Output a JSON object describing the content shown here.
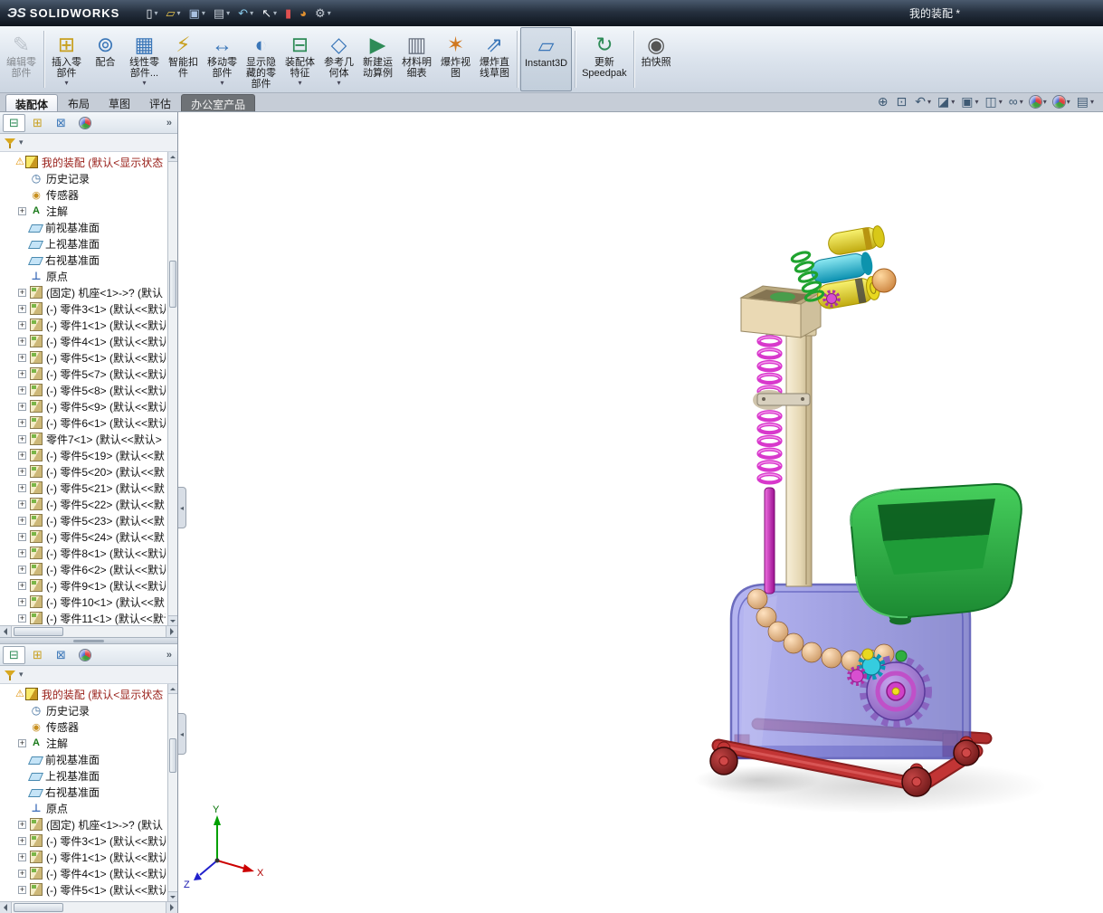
{
  "titlebar": {
    "logo_mark": "ЭS",
    "logo_text": "SOLIDWORKS",
    "title": "我的装配 *",
    "quick_icons": [
      {
        "name": "new-document-icon",
        "glyph": "▯",
        "color": "#f0f4f8",
        "flags": "dd"
      },
      {
        "name": "open-folder-icon",
        "glyph": "▱",
        "color": "#e8c44a",
        "flags": "dd"
      },
      {
        "name": "save-icon",
        "glyph": "▣",
        "color": "#a8c0e0",
        "flags": "dd"
      },
      {
        "name": "print-icon",
        "glyph": "▤",
        "color": "#c2cad4",
        "flags": "dd"
      },
      {
        "name": "undo-icon",
        "glyph": "↶",
        "color": "#88c8e8",
        "flags": "dd"
      },
      {
        "name": "select-cursor-icon",
        "glyph": "↖",
        "color": "#f0f4f8",
        "flags": "dd"
      },
      {
        "name": "rebuild-icon",
        "glyph": "▮",
        "color": "#e05050",
        "flags": ""
      },
      {
        "name": "appearance-icon",
        "glyph": "◕",
        "color": "#e09030",
        "flags": ""
      },
      {
        "name": "options-icon",
        "glyph": "⚙",
        "color": "#c6cdd6",
        "flags": "dd"
      }
    ]
  },
  "ribbon": {
    "buttons": [
      {
        "name": "edit-component-button",
        "label": "编辑零\n部件",
        "glyph": "✎",
        "color": "#8a929c",
        "flags": "disabled"
      },
      {
        "divider": true
      },
      {
        "name": "insert-component-button",
        "label": "插入零\n部件",
        "glyph": "⊞",
        "color": "#c8a020",
        "flags": "dd"
      },
      {
        "name": "mate-button",
        "label": "配合",
        "glyph": "⊚",
        "color": "#3a76b8",
        "flags": ""
      },
      {
        "name": "linear-component-pattern-button",
        "label": "线性零\n部件...",
        "glyph": "▦",
        "color": "#3a76b8",
        "flags": "dd"
      },
      {
        "name": "smart-fasteners-button",
        "label": "智能扣\n件",
        "glyph": "⚡",
        "color": "#c8a020",
        "flags": ""
      },
      {
        "name": "move-component-button",
        "label": "移动零\n部件",
        "glyph": "↔",
        "color": "#3a76b8",
        "flags": "dd"
      },
      {
        "name": "show-hidden-components-button",
        "label": "显示隐\n藏的零\n部件",
        "glyph": "◐",
        "color": "#3a76b8",
        "flags": ""
      },
      {
        "name": "assembly-features-button",
        "label": "装配体\n特征",
        "glyph": "⊟",
        "color": "#2e8b57",
        "flags": "dd"
      },
      {
        "name": "reference-geometry-button",
        "label": "参考几\n何体",
        "glyph": "◇",
        "color": "#3a76b8",
        "flags": "dd"
      },
      {
        "name": "new-motion-study-button",
        "label": "新建运\n动算例",
        "glyph": "▶",
        "color": "#2e8b57",
        "flags": ""
      },
      {
        "name": "bill-of-materials-button",
        "label": "材料明\n细表",
        "glyph": "▥",
        "color": "#6a7280",
        "flags": ""
      },
      {
        "name": "exploded-view-button",
        "label": "爆炸视\n图",
        "glyph": "✶",
        "color": "#d07820",
        "flags": ""
      },
      {
        "name": "explode-line-sketch-button",
        "label": "爆炸直\n线草图",
        "glyph": "⇗",
        "color": "#3a76b8",
        "flags": ""
      },
      {
        "divider": true
      },
      {
        "name": "instant3d-button",
        "label": "Instant3D",
        "glyph": "▱",
        "color": "#3a76b8",
        "flags": "active"
      },
      {
        "divider": true
      },
      {
        "name": "update-speedpak-button",
        "label": "更新\nSpeedpak",
        "glyph": "↻",
        "color": "#2e8b57",
        "flags": ""
      },
      {
        "divider": true
      },
      {
        "name": "take-snapshot-button",
        "label": "拍快照",
        "glyph": "◉",
        "color": "#555555",
        "flags": ""
      }
    ]
  },
  "tabs": {
    "items": [
      {
        "name": "tab-assembly",
        "label": "装配体",
        "flags": "active"
      },
      {
        "name": "tab-layout",
        "label": "布局",
        "flags": ""
      },
      {
        "name": "tab-sketch",
        "label": "草图",
        "flags": ""
      },
      {
        "name": "tab-evaluate",
        "label": "评估",
        "flags": ""
      },
      {
        "name": "tab-office-products",
        "label": "办公室产品",
        "flags": "dark"
      }
    ]
  },
  "viewtools": {
    "items": [
      {
        "name": "zoom-fit-icon",
        "glyph": "⊕",
        "color": "#3f5a74",
        "flags": ""
      },
      {
        "name": "zoom-to-area-icon",
        "glyph": "⊡",
        "color": "#3f5a74",
        "flags": ""
      },
      {
        "name": "previous-view-icon",
        "glyph": "↶",
        "color": "#3f5a74",
        "flags": "dd"
      },
      {
        "name": "section-view-icon",
        "glyph": "◪",
        "color": "#3f5a74",
        "flags": "dd"
      },
      {
        "name": "view-orientation-icon",
        "glyph": "▣",
        "color": "#3f5a74",
        "flags": "dd"
      },
      {
        "name": "display-style-icon",
        "glyph": "◫",
        "color": "#3f5a74",
        "flags": "dd"
      },
      {
        "name": "hide-show-items-icon",
        "glyph": "∞",
        "color": "#3f5a74",
        "flags": "dd"
      },
      {
        "name": "edit-appearance-icon",
        "glyph": "●",
        "color": "#3f5a74",
        "flags": "ball dd"
      },
      {
        "name": "apply-scene-icon",
        "glyph": "●",
        "color": "#3f5a74",
        "flags": "ball dd"
      },
      {
        "name": "view-settings-icon",
        "glyph": "▤",
        "color": "#3f5a74",
        "flags": "dd"
      }
    ]
  },
  "panels": {
    "tabs": [
      {
        "name": "featuremanager-tree-tab",
        "glyph": "⊟",
        "color": "#2e8b57",
        "flags": "active"
      },
      {
        "name": "propertymanager-tab",
        "glyph": "⊞",
        "color": "#c8a020",
        "flags": ""
      },
      {
        "name": "configurationmanager-tab",
        "glyph": "⊠",
        "color": "#3a76b8",
        "flags": ""
      },
      {
        "name": "displaymanager-tab",
        "glyph": "●",
        "color": "#3f5a74",
        "flags": "ball"
      }
    ],
    "tree1": [
      {
        "icon": "assembly",
        "flags": "root warn red",
        "label": "我的装配 (默认<显示状态"
      },
      {
        "icon": "history",
        "flags": "",
        "label": "历史记录"
      },
      {
        "icon": "sensor",
        "flags": "",
        "label": "传感器"
      },
      {
        "icon": "annot",
        "flags": "exp",
        "label": "注解"
      },
      {
        "icon": "plane",
        "flags": "",
        "label": "前视基准面"
      },
      {
        "icon": "plane",
        "flags": "",
        "label": "上视基准面"
      },
      {
        "icon": "plane",
        "flags": "",
        "label": "右视基准面"
      },
      {
        "icon": "origin",
        "flags": "",
        "label": "原点"
      },
      {
        "icon": "part",
        "flags": "exp",
        "label": "(固定) 机座<1>->? (默认"
      },
      {
        "icon": "part",
        "flags": "exp",
        "label": "(-) 零件3<1> (默认<<默认"
      },
      {
        "icon": "part",
        "flags": "exp",
        "label": "(-) 零件1<1> (默认<<默认"
      },
      {
        "icon": "part",
        "flags": "exp",
        "label": "(-) 零件4<1> (默认<<默认"
      },
      {
        "icon": "part",
        "flags": "exp",
        "label": "(-) 零件5<1> (默认<<默认"
      },
      {
        "icon": "part",
        "flags": "exp",
        "label": "(-) 零件5<7> (默认<<默认"
      },
      {
        "icon": "part",
        "flags": "exp",
        "label": "(-) 零件5<8> (默认<<默认"
      },
      {
        "icon": "part",
        "flags": "exp",
        "label": "(-) 零件5<9> (默认<<默认"
      },
      {
        "icon": "part",
        "flags": "exp",
        "label": "(-) 零件6<1> (默认<<默认"
      },
      {
        "icon": "part",
        "flags": "exp",
        "label": "零件7<1> (默认<<默认>"
      },
      {
        "icon": "part",
        "flags": "exp",
        "label": "(-) 零件5<19> (默认<<默"
      },
      {
        "icon": "part",
        "flags": "exp",
        "label": "(-) 零件5<20> (默认<<默"
      },
      {
        "icon": "part",
        "flags": "exp",
        "label": "(-) 零件5<21> (默认<<默"
      },
      {
        "icon": "part",
        "flags": "exp",
        "label": "(-) 零件5<22> (默认<<默"
      },
      {
        "icon": "part",
        "flags": "exp",
        "label": "(-) 零件5<23> (默认<<默"
      },
      {
        "icon": "part",
        "flags": "exp",
        "label": "(-) 零件5<24> (默认<<默"
      },
      {
        "icon": "part",
        "flags": "exp",
        "label": "(-) 零件8<1> (默认<<默认"
      },
      {
        "icon": "part",
        "flags": "exp",
        "label": "(-) 零件6<2> (默认<<默认"
      },
      {
        "icon": "part",
        "flags": "exp",
        "label": "(-) 零件9<1> (默认<<默认"
      },
      {
        "icon": "part",
        "flags": "exp",
        "label": "(-) 零件10<1> (默认<<默"
      },
      {
        "icon": "part",
        "flags": "exp",
        "label": "(-) 零件11<1> (默认<<默认"
      }
    ],
    "tree2": [
      {
        "icon": "assembly",
        "flags": "root warn red",
        "label": "我的装配 (默认<显示状态"
      },
      {
        "icon": "history",
        "flags": "",
        "label": "历史记录"
      },
      {
        "icon": "sensor",
        "flags": "",
        "label": "传感器"
      },
      {
        "icon": "annot",
        "flags": "exp",
        "label": "注解"
      },
      {
        "icon": "plane",
        "flags": "",
        "label": "前视基准面"
      },
      {
        "icon": "plane",
        "flags": "",
        "label": "上视基准面"
      },
      {
        "icon": "plane",
        "flags": "",
        "label": "右视基准面"
      },
      {
        "icon": "origin",
        "flags": "",
        "label": "原点"
      },
      {
        "icon": "part",
        "flags": "exp",
        "label": "(固定) 机座<1>->? (默认"
      },
      {
        "icon": "part",
        "flags": "exp",
        "label": "(-) 零件3<1> (默认<<默认"
      },
      {
        "icon": "part",
        "flags": "exp",
        "label": "(-) 零件1<1> (默认<<默认"
      },
      {
        "icon": "part",
        "flags": "exp",
        "label": "(-) 零件4<1> (默认<<默认"
      },
      {
        "icon": "part",
        "flags": "exp",
        "label": "(-) 零件5<1> (默认<<默认"
      }
    ]
  },
  "triad": {
    "x_label": "X",
    "y_label": "Y",
    "z_label": "Z"
  },
  "model": {
    "colors": {
      "base": "#c23535",
      "wheels": "#7a1515",
      "body": "#8585d8",
      "body_edge": "#4444ac",
      "bowl": "#2fae45",
      "column": "#e8dcbc",
      "screw": "#d838cc",
      "cyl_yellow": "#e8d820",
      "cyl_cyan": "#20c0d8",
      "spiral": "#1fa32f",
      "ball": "#e0a060",
      "chain": "#e8bc92",
      "gear_large": "#9a76d0",
      "gear_small_cyan": "#28c0d8",
      "gear_small_magenta": "#d048c0"
    }
  }
}
